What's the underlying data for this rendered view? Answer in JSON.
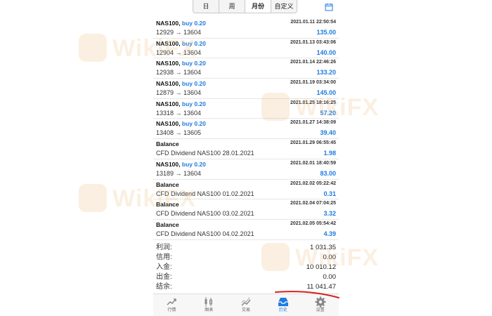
{
  "tabs": [
    {
      "label": "日"
    },
    {
      "label": "周"
    },
    {
      "label": "月份"
    },
    {
      "label": "自定义"
    }
  ],
  "active_tab": "月份",
  "rows": [
    {
      "title": "NAS100,",
      "side": "buy 0.20",
      "detail": "12929 → 13604",
      "datetime": "2021.01.11 22:50:54",
      "amount": "135.00"
    },
    {
      "title": "NAS100,",
      "side": "buy 0.20",
      "detail": "12904 → 13604",
      "datetime": "2021.01.13 03:43:06",
      "amount": "140.00"
    },
    {
      "title": "NAS100,",
      "side": "buy 0.20",
      "detail": "12938 → 13604",
      "datetime": "2021.01.14 22:46:26",
      "amount": "133.20"
    },
    {
      "title": "NAS100,",
      "side": "buy 0.20",
      "detail": "12879 → 13604",
      "datetime": "2021.01.19 03:34:00",
      "amount": "145.00"
    },
    {
      "title": "NAS100,",
      "side": "buy 0.20",
      "detail": "13318 → 13604",
      "datetime": "2021.01.25 18:16:25",
      "amount": "57.20"
    },
    {
      "title": "NAS100,",
      "side": "buy 0.20",
      "detail": "13408 → 13605",
      "datetime": "2021.01.27 14:38:09",
      "amount": "39.40"
    },
    {
      "title": "Balance",
      "side": "",
      "detail": "CFD Dividend NAS100 28.01.2021",
      "datetime": "2021.01.29 06:55:45",
      "amount": "1.98"
    },
    {
      "title": "NAS100,",
      "side": "buy 0.20",
      "detail": "13189 → 13604",
      "datetime": "2021.02.01 18:40:59",
      "amount": "83.00"
    },
    {
      "title": "Balance",
      "side": "",
      "detail": "CFD Dividend NAS100 01.02.2021",
      "datetime": "2021.02.02 05:22:42",
      "amount": "0.31"
    },
    {
      "title": "Balance",
      "side": "",
      "detail": "CFD Dividend NAS100 03.02.2021",
      "datetime": "2021.02.04 07:04:25",
      "amount": "3.32"
    },
    {
      "title": "Balance",
      "side": "",
      "detail": "CFD Dividend NAS100 04.02.2021",
      "datetime": "2021.02.05 05:54:42",
      "amount": "4.39"
    }
  ],
  "summary": [
    {
      "label": "利润:",
      "value": "1 031.35"
    },
    {
      "label": "信用:",
      "value": "0.00"
    },
    {
      "label": "入金:",
      "value": "10 010.12"
    },
    {
      "label": "出金:",
      "value": "0.00"
    },
    {
      "label": "结余:",
      "value": "11 041.47"
    }
  ],
  "nav": [
    {
      "label": "行情",
      "icon": "quotes-icon"
    },
    {
      "label": "图表",
      "icon": "chart-icon"
    },
    {
      "label": "交易",
      "icon": "trade-icon"
    },
    {
      "label": "历史",
      "icon": "history-icon"
    },
    {
      "label": "设置",
      "icon": "settings-icon"
    }
  ],
  "active_nav": "历史",
  "watermark": "WikiFX",
  "colors": {
    "accent": "#1e7be0",
    "annotation": "#d62020"
  }
}
